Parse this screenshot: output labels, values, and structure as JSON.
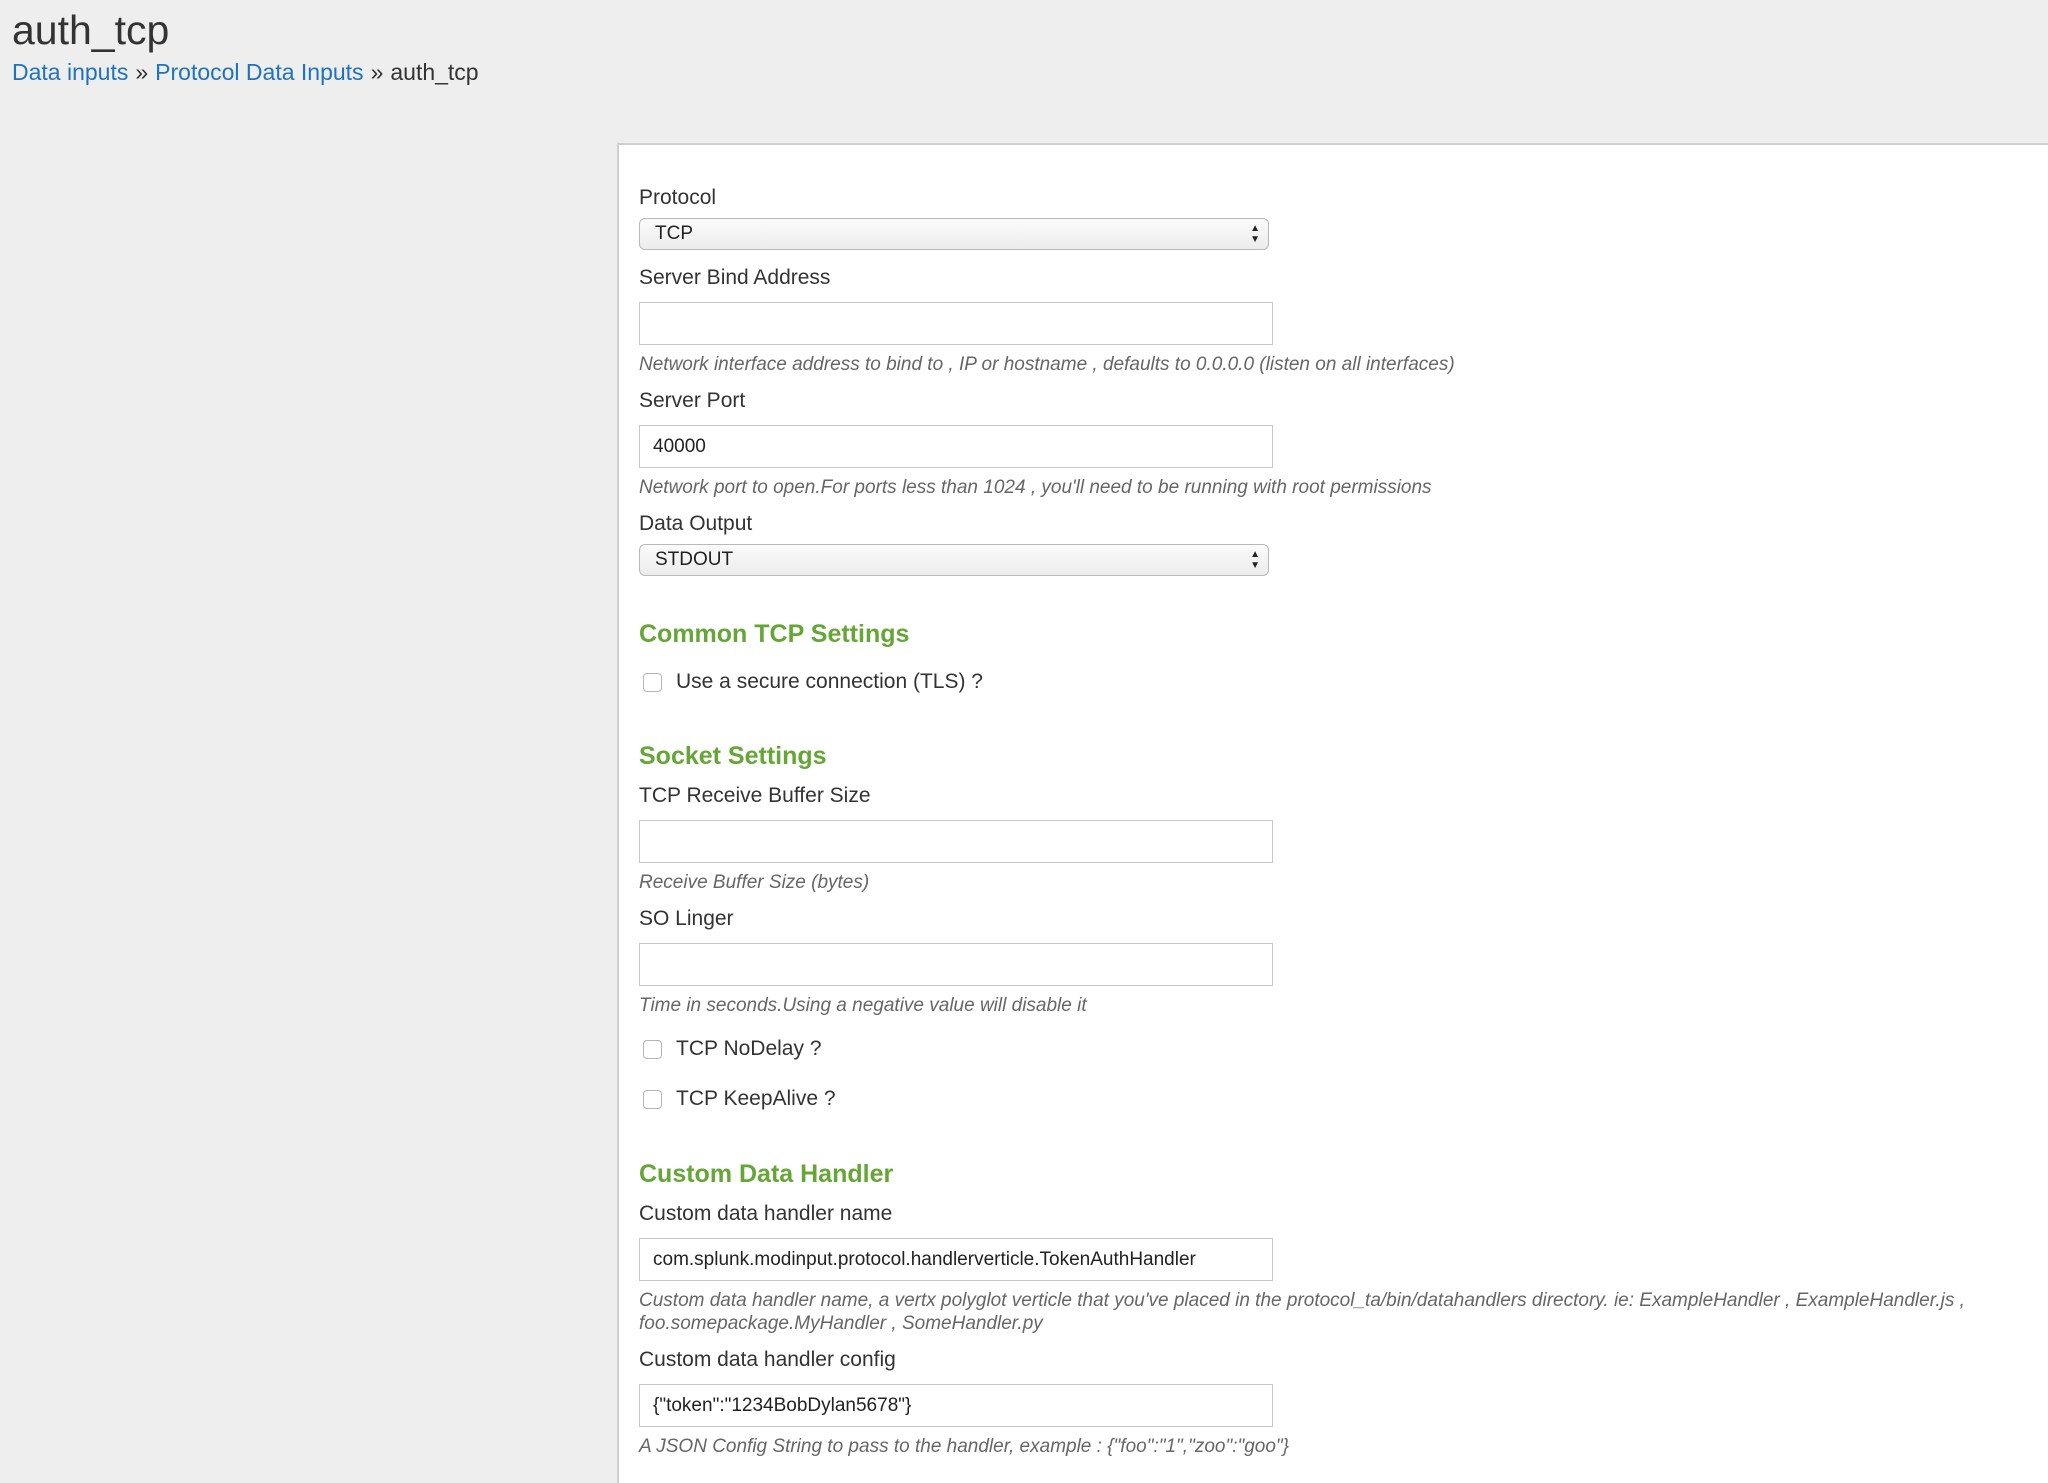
{
  "page": {
    "title": "auth_tcp"
  },
  "breadcrumb": {
    "items": [
      "Data inputs",
      "Protocol Data Inputs"
    ],
    "separator": "»",
    "current": "auth_tcp"
  },
  "form": {
    "protocol": {
      "label": "Protocol",
      "value": "TCP"
    },
    "bind_address": {
      "label": "Server Bind Address",
      "value": "",
      "help": "Network interface address to bind to , IP or hostname , defaults to 0.0.0.0 (listen on all interfaces)"
    },
    "port": {
      "label": "Server Port",
      "value": "40000",
      "help": "Network port to open.For ports less than 1024 , you'll need to be running with root permissions"
    },
    "data_output": {
      "label": "Data Output",
      "value": "STDOUT"
    },
    "common_tcp": {
      "header": "Common TCP Settings",
      "tls_label": "Use a secure connection (TLS) ?"
    },
    "socket": {
      "header": "Socket Settings",
      "rcvbuf": {
        "label": "TCP Receive Buffer Size",
        "value": "",
        "help": "Receive Buffer Size (bytes)"
      },
      "linger": {
        "label": "SO Linger",
        "value": "",
        "help": "Time in seconds.Using a negative value will disable it"
      },
      "nodelay_label": "TCP NoDelay ?",
      "keepalive_label": "TCP KeepAlive ?"
    },
    "custom_handler": {
      "header": "Custom Data Handler",
      "name": {
        "label": "Custom data handler name",
        "value": "com.splunk.modinput.protocol.handlerverticle.TokenAuthHandler",
        "help_line1": "Custom data handler name, a vertx polyglot verticle that you've placed in the protocol_ta/bin/datahandlers directory. ie: ExampleHandler , ExampleHandler.js ,",
        "help_line2": "foo.somepackage.MyHandler , SomeHandler.py"
      },
      "config": {
        "label": "Custom data handler config",
        "value": "{\"token\":\"1234BobDylan5678\"}",
        "help": "A JSON Config String to pass to the handler, example : {\"foo\":\"1\",\"zoo\":\"goo\"}"
      }
    }
  },
  "colors": {
    "background": "#eeeeee",
    "link": "#1e73be",
    "section_header": "#65a637",
    "help_text": "#666666"
  },
  "icons": {
    "select_arrows": "up-down-arrows-icon"
  }
}
